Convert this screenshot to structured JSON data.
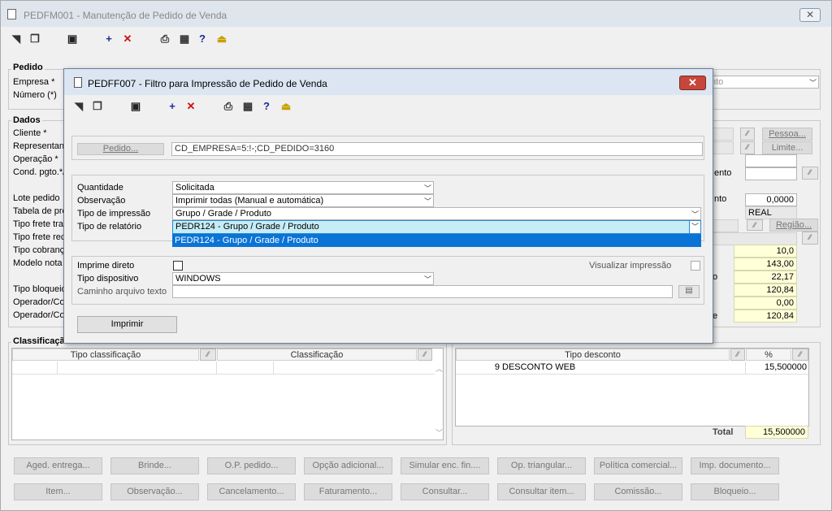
{
  "main": {
    "title": "PEDFM001 - Manutenção de Pedido de Venda",
    "close_glyph": "✕",
    "pedido_group": "Pedido",
    "empresa_label": "Empresa *",
    "numero_label": "Número (*)",
    "empresa_suffix": "nto",
    "dados_group": "Dados",
    "dados_labels": [
      "Cliente *",
      "Representan",
      "Operação *",
      "Cond. pgto.*/",
      "Lote pedido",
      "Tabela de pre",
      "Tipo frete tra",
      "Tipo frete rec",
      "Tipo cobranç",
      "Modelo nota",
      "Tipo bloqueio",
      "Operador/Co",
      "Operador/Co"
    ],
    "pessoa_button": "Pessoa...",
    "limite_button": "Limite...",
    "regiao_button": "Região...",
    "mento_label": "ento",
    "nto_label2": "nto",
    "lote_value": "0,0000",
    "tabela_value": "REAL",
    "o_label": "o",
    "e_label": "e",
    "right_values": [
      "10,0",
      "143,00",
      "22,17",
      "120,84",
      "0,00",
      "120,84"
    ],
    "classificacao_group": "Classificação",
    "class_headers": [
      "Tipo classificação",
      "Classificação"
    ],
    "desconto_headers": [
      "Tipo desconto",
      "%"
    ],
    "desconto_row": {
      "code": "9",
      "name": "DESCONTO WEB",
      "pct": "15,500000"
    },
    "total_label": "Total",
    "total_value": "15,500000",
    "buttons_row1": [
      "Aged. entrega...",
      "Brinde...",
      "O.P. pedido...",
      "Opção adicional...",
      "Simular enc. fin....",
      "Op. triangular...",
      "Política comercial...",
      "Imp. documento..."
    ],
    "buttons_row2": [
      "Item...",
      "Observação...",
      "Cancelamento...",
      "Faturamento...",
      "Consultar...",
      "Consultar item...",
      "Comissão...",
      "Bloqueio..."
    ]
  },
  "dialog": {
    "title": "PEDFF007 - Filtro para Impressão de Pedido de Venda",
    "pedido_button": "Pedido...",
    "pedido_value": "CD_EMPRESA=5:!-;CD_PEDIDO=3160",
    "quantidade_label": "Quantidade",
    "quantidade_value": "Solicitada",
    "observacao_label": "Observação",
    "observacao_value": "Imprimir todas (Manual e automática)",
    "tipo_impressao_label": "Tipo de impressão",
    "tipo_impressao_value": "Grupo / Grade / Produto",
    "tipo_relatorio_label": "Tipo de relatório",
    "tipo_relatorio_value": "PEDR124 - Grupo / Grade / Produto",
    "dropdown_option": "PEDR124 - Grupo / Grade / Produto",
    "imprime_direto_label": "Imprime direto",
    "visualizar_label": "Visualizar impressão",
    "tipo_dispositivo_label": "Tipo dispositivo",
    "tipo_dispositivo_value": "WINDOWS",
    "caminho_label": "Caminho arquivo texto",
    "caminho_value": "",
    "imprimir_button": "Imprimir"
  }
}
